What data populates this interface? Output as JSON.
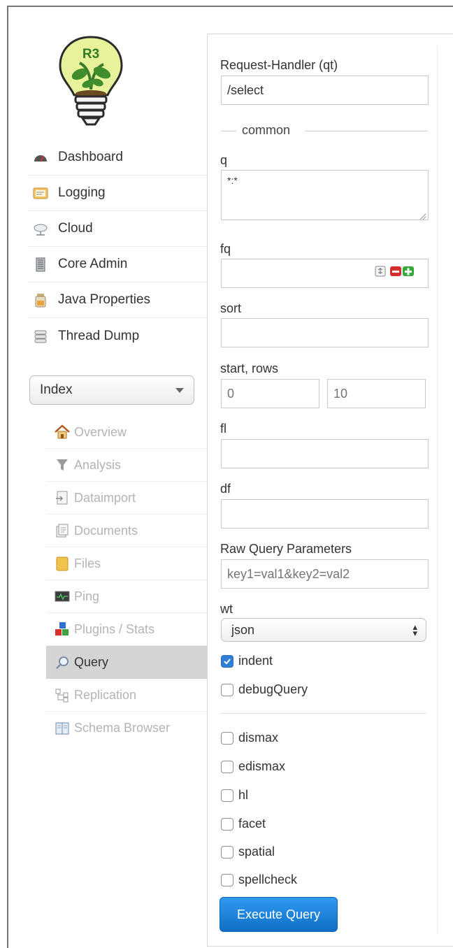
{
  "nav": {
    "items": [
      {
        "label": "Dashboard",
        "icon": "dashboard-icon"
      },
      {
        "label": "Logging",
        "icon": "logging-icon"
      },
      {
        "label": "Cloud",
        "icon": "cloud-icon"
      },
      {
        "label": "Core Admin",
        "icon": "core-admin-icon"
      },
      {
        "label": "Java Properties",
        "icon": "java-properties-icon"
      },
      {
        "label": "Thread Dump",
        "icon": "thread-dump-icon"
      }
    ]
  },
  "logo": {
    "text": "R3"
  },
  "core_selector": {
    "value": "Index"
  },
  "subnav": {
    "items": [
      {
        "label": "Overview",
        "icon": "home-icon"
      },
      {
        "label": "Analysis",
        "icon": "filter-icon"
      },
      {
        "label": "Dataimport",
        "icon": "dataimport-icon"
      },
      {
        "label": "Documents",
        "icon": "documents-icon"
      },
      {
        "label": "Files",
        "icon": "folder-icon"
      },
      {
        "label": "Ping",
        "icon": "ping-icon"
      },
      {
        "label": "Plugins / Stats",
        "icon": "plugins-icon"
      },
      {
        "label": "Query",
        "icon": "magnifier-icon",
        "active": true
      },
      {
        "label": "Replication",
        "icon": "replication-icon"
      },
      {
        "label": "Schema Browser",
        "icon": "schema-browser-icon"
      }
    ]
  },
  "form": {
    "request_handler_label": "Request-Handler (qt)",
    "request_handler_value": "/select",
    "common_legend": "common",
    "q_label": "q",
    "q_value": "*:*",
    "fq_label": "fq",
    "fq_value": "",
    "sort_label": "sort",
    "sort_value": "",
    "start_rows_label": "start, rows",
    "start_placeholder": "0",
    "rows_placeholder": "10",
    "fl_label": "fl",
    "fl_value": "",
    "df_label": "df",
    "df_value": "",
    "raw_label": "Raw Query Parameters",
    "raw_placeholder": "key1=val1&key2=val2",
    "wt_label": "wt",
    "wt_value": "json",
    "indent_label": "indent",
    "indent_checked": true,
    "debug_label": "debugQuery",
    "debug_checked": false,
    "options": [
      {
        "label": "dismax",
        "checked": false
      },
      {
        "label": "edismax",
        "checked": false
      },
      {
        "label": "hl",
        "checked": false
      },
      {
        "label": "facet",
        "checked": false
      },
      {
        "label": "spatial",
        "checked": false
      },
      {
        "label": "spellcheck",
        "checked": false
      }
    ],
    "execute_label": "Execute Query"
  },
  "colors": {
    "accent": "#1a7fd6",
    "active_nav_bg": "#d4d4d4",
    "check_blue": "#2f7fd8"
  }
}
